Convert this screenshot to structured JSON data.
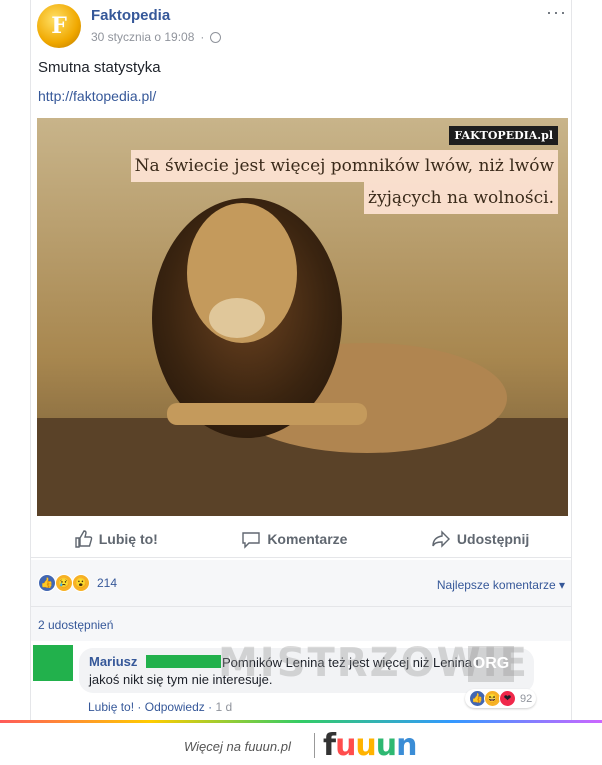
{
  "post": {
    "page_name": "Faktopedia",
    "timestamp": "30 stycznia o 19:08",
    "avatar_letter": "F",
    "more_label": "···",
    "text": "Smutna statystyka",
    "link": "http://faktopedia.pl/",
    "image": {
      "watermark": "FAKTOPEDIA.pl",
      "quote_line1": "Na świecie jest więcej pomników lwów, niż lwów",
      "quote_line2": "żyjących na wolności."
    }
  },
  "actions": {
    "like": "Lubię to!",
    "comment": "Komentarze",
    "share": "Udostępnij"
  },
  "reactions": {
    "count": "214",
    "sort_label": "Najlepsze komentarze",
    "types": [
      "like",
      "sad",
      "wow"
    ]
  },
  "shares": "2 udostępnień",
  "comment": {
    "author": "Mariusz",
    "text_line1": "Pomników Lenina też jest więcej niż Lenina i",
    "text_line2": "jakoś nikt się tym nie interesuje.",
    "reaction_count": "92",
    "like_label": "Lubię to!",
    "reply_label": "Odpowiedz",
    "time": "1 d"
  },
  "overlay_watermark": {
    "text": "MISTRZOWIE",
    "suffix": "ORG"
  },
  "footer": {
    "tagline": "Więcej na fuuun.pl",
    "logo": [
      "f",
      "u",
      "u",
      "u",
      "n"
    ]
  },
  "colors": {
    "link_blue": "#365899",
    "like_blue": "#4267b2",
    "emoji_yellow": "#f7b125",
    "censor_green": "#22b14c"
  }
}
